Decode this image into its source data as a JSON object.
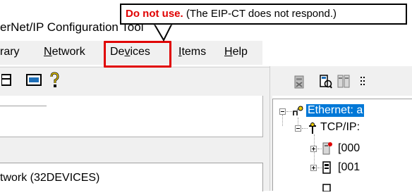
{
  "window": {
    "title": "erNet/IP Configuration Tool"
  },
  "menu": {
    "items": [
      {
        "label": "rary"
      },
      {
        "prefix": "",
        "underline": "N",
        "suffix": "etwork"
      },
      {
        "prefix": "De",
        "underline": "v",
        "suffix": "ices"
      },
      {
        "prefix": "",
        "underline": "I",
        "suffix": "tems"
      },
      {
        "prefix": "",
        "underline": "H",
        "suffix": "elp"
      }
    ]
  },
  "callout": {
    "warning": "Do not use.",
    "note": " (The EIP-CT does not respond.)"
  },
  "left_pane": {
    "network_label": "twork (32DEVICES)"
  },
  "tree": {
    "root_label": "Ethernet: a",
    "tcpip_label": "TCP/IP:",
    "device_1": "[000",
    "device_2": "[001"
  },
  "toolbar": {
    "left_icons": [
      "view-icon",
      "layout-icon",
      "help-icon"
    ],
    "right_icons": [
      "delete-device-icon",
      "device-properties-icon",
      "device-compare-icon",
      "more-icon"
    ]
  },
  "colors": {
    "highlight": "#e00000",
    "selection": "#0078d7",
    "panel": "#f0f0f0"
  }
}
